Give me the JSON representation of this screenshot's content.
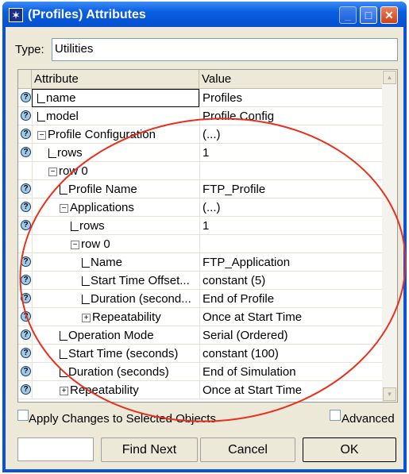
{
  "window": {
    "title": "(Profiles) Attributes"
  },
  "type": {
    "label": "Type:",
    "value": "Utilities"
  },
  "table": {
    "headers": [
      "Attribute",
      "Value"
    ],
    "rows": [
      {
        "level": 0,
        "kind": "first",
        "attr": "name",
        "value": "Profiles",
        "help": true
      },
      {
        "level": 0,
        "kind": "leaf",
        "attr": "model",
        "value": "Profile Config",
        "help": true
      },
      {
        "level": 0,
        "kind": "minus",
        "attr": "Profile Configuration",
        "value": "(...)",
        "help": true
      },
      {
        "level": 1,
        "kind": "leaf",
        "attr": "rows",
        "value": "1",
        "help": true
      },
      {
        "level": 1,
        "kind": "minus",
        "attr": "row 0",
        "value": "",
        "help": false
      },
      {
        "level": 2,
        "kind": "leaf",
        "attr": "Profile Name",
        "value": "FTP_Profile",
        "help": true
      },
      {
        "level": 2,
        "kind": "minus",
        "attr": "Applications",
        "value": "(...)",
        "help": true
      },
      {
        "level": 3,
        "kind": "leaf",
        "attr": "rows",
        "value": "1",
        "help": true
      },
      {
        "level": 3,
        "kind": "minus",
        "attr": "row 0",
        "value": "",
        "help": false
      },
      {
        "level": 4,
        "kind": "leaf",
        "attr": "Name",
        "value": "FTP_Application",
        "help": true
      },
      {
        "level": 4,
        "kind": "leaf",
        "attr": "Start Time Offset...",
        "value": "constant (5)",
        "help": true
      },
      {
        "level": 4,
        "kind": "leaf",
        "attr": "Duration (second...",
        "value": "End of Profile",
        "help": true
      },
      {
        "level": 4,
        "kind": "plus",
        "attr": "Repeatability",
        "value": "Once at Start Time",
        "help": true
      },
      {
        "level": 2,
        "kind": "leaf",
        "attr": "Operation Mode",
        "value": "Serial (Ordered)",
        "help": true
      },
      {
        "level": 2,
        "kind": "leaf",
        "attr": "Start Time (seconds)",
        "value": "constant (100)",
        "help": true
      },
      {
        "level": 2,
        "kind": "leaf",
        "attr": "Duration (seconds)",
        "value": "End of Simulation",
        "help": true
      },
      {
        "level": 2,
        "kind": "plus",
        "attr": "Repeatability",
        "value": "Once at Start Time",
        "help": true
      }
    ]
  },
  "options": {
    "apply": "Apply Changes to Selected Objects",
    "advanced": "Advanced",
    "apply_checked": false,
    "advanced_checked": false
  },
  "buttons": {
    "find_input": "",
    "find_next": "Find Next",
    "cancel": "Cancel",
    "ok": "OK"
  },
  "annotation": {
    "color": "#e8301c"
  }
}
